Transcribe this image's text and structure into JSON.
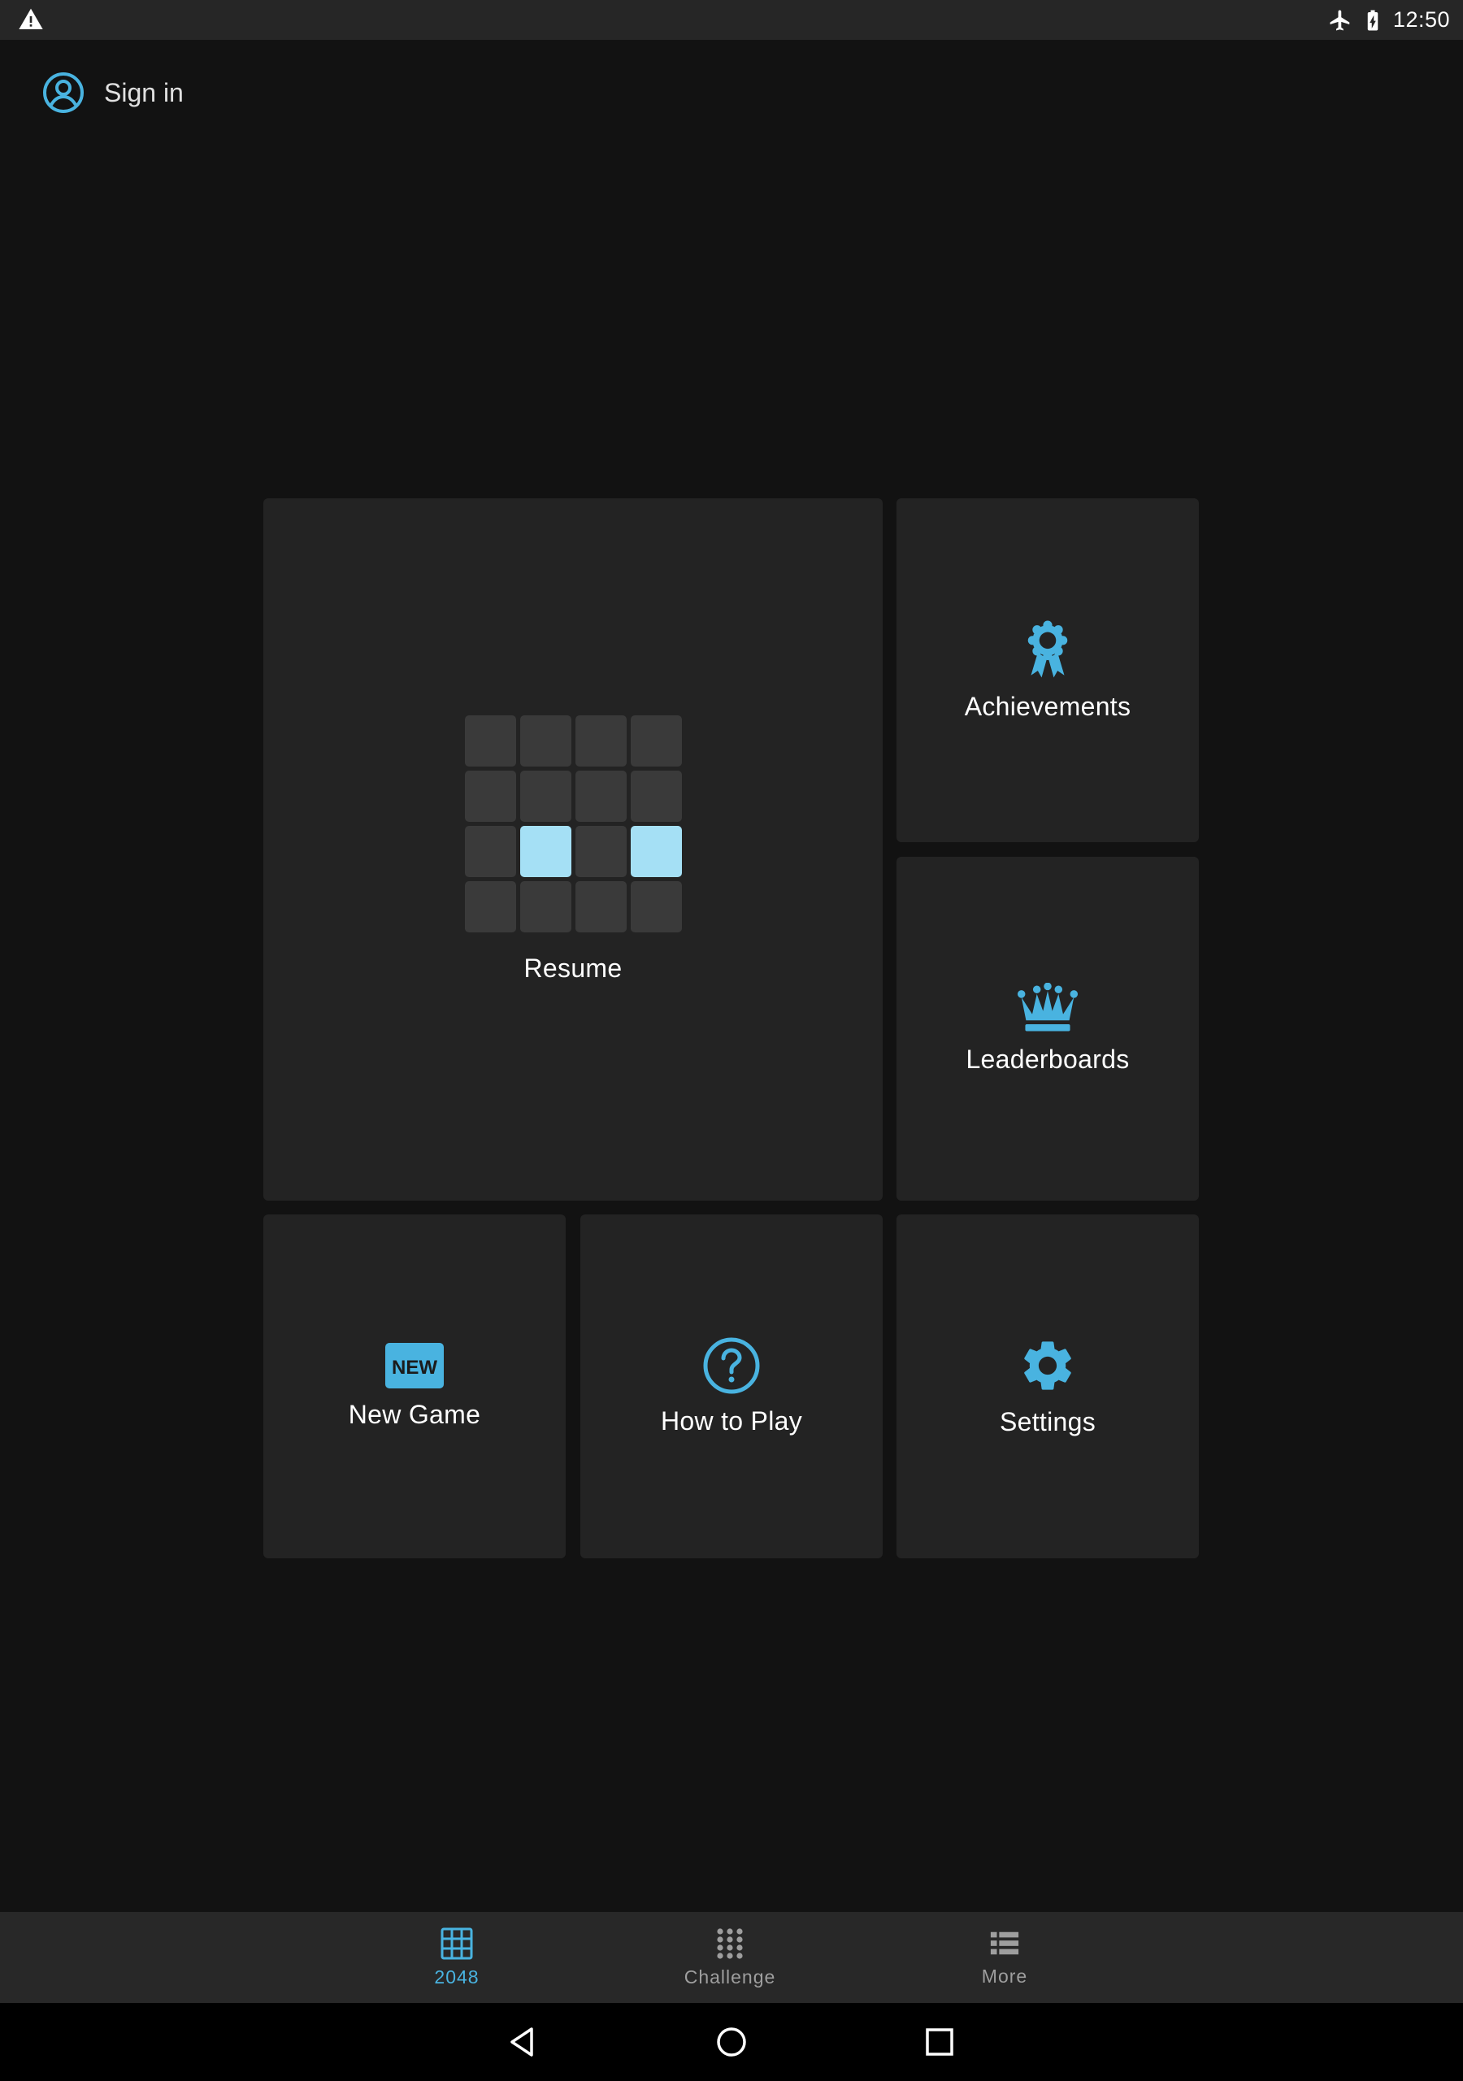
{
  "colors": {
    "accent": "#49b3e0",
    "tile_bg": "#232323",
    "page_bg": "#121212",
    "lit_cell": "#a5e0f5",
    "nav_inactive": "#9e9e9e"
  },
  "status_bar": {
    "time": "12:50",
    "icons": [
      "warning-icon",
      "airplane-mode-icon",
      "battery-charging-icon"
    ]
  },
  "account": {
    "signin_label": "Sign in",
    "icon": "account-circle-icon"
  },
  "menu": {
    "resume": {
      "label": "Resume",
      "preview_lit_cells": [
        9,
        11
      ]
    },
    "achievements": {
      "label": "Achievements",
      "icon": "award-ribbon-icon"
    },
    "leaderboards": {
      "label": "Leaderboards",
      "icon": "crown-icon"
    },
    "new_game": {
      "label": "New Game",
      "icon": "new-badge-icon",
      "badge_text": "NEW"
    },
    "how_to_play": {
      "label": "How to Play",
      "icon": "help-circle-icon"
    },
    "settings": {
      "label": "Settings",
      "icon": "gear-icon"
    }
  },
  "bottom_nav": {
    "selected": "2048",
    "items": [
      {
        "label": "2048",
        "icon": "grid-icon"
      },
      {
        "label": "Challenge",
        "icon": "dots-grid-icon"
      },
      {
        "label": "More",
        "icon": "list-icon"
      }
    ]
  }
}
